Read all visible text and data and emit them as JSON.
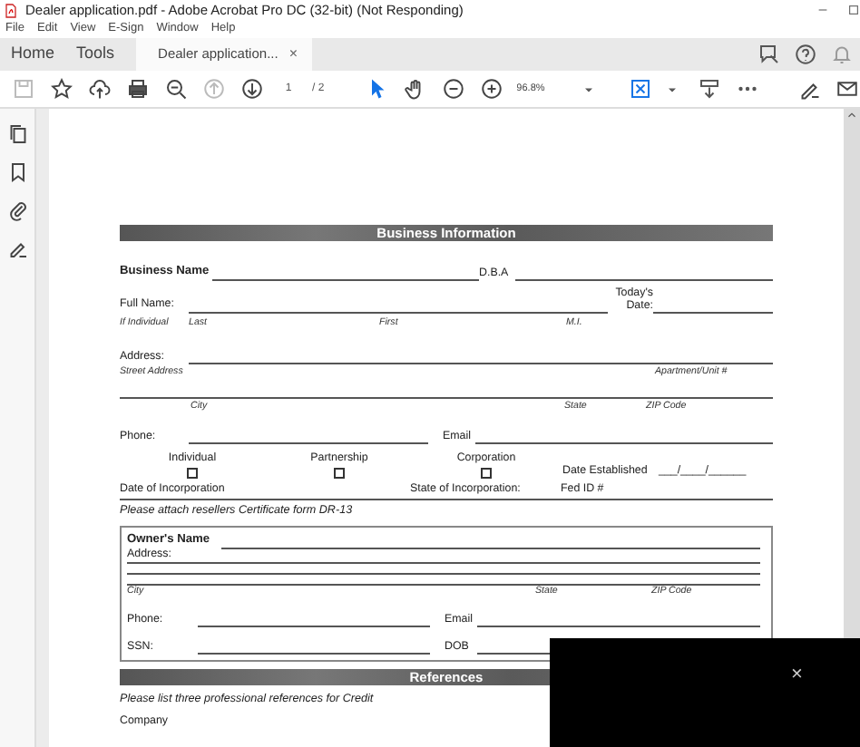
{
  "window": {
    "title": "Dealer application.pdf - Adobe Acrobat Pro DC (32-bit) (Not Responding)"
  },
  "menu": [
    "File",
    "Edit",
    "View",
    "E-Sign",
    "Window",
    "Help"
  ],
  "tabs": [
    {
      "label": "Home",
      "selected": false
    },
    {
      "label": "Tools",
      "selected": false
    },
    {
      "label": "Dealer application...",
      "selected": true,
      "close": "×"
    }
  ],
  "toolbar": {
    "buttons": [
      {
        "disabled": true
      },
      {
        "disabled": false
      },
      {
        "disabled": false
      },
      {
        "disabled": false
      },
      {
        "disabled": false
      },
      {
        "disabled": true
      },
      {
        "disabled": false
      }
    ],
    "page": "1",
    "page_total": "/ 2",
    "tools": [
      {
        "selected": true
      },
      {
        "selected": false
      }
    ],
    "zoom": "96.8%"
  },
  "form": [
    {
      "kind": "heading",
      "text": "Business Information"
    },
    {
      "kind": "row",
      "items": [
        {
          "kind": "strong",
          "text": "Business Name"
        },
        {
          "kind": "line"
        },
        {
          "kind": "label",
          "text": "D.B.A"
        },
        {
          "kind": "line"
        }
      ]
    },
    {
      "kind": "row",
      "items": [
        {
          "kind": "label",
          "text": "Full Name:"
        },
        {
          "kind": "line"
        },
        {
          "kind": "label",
          "text": "Today's Date:"
        },
        {
          "kind": "line"
        }
      ]
    },
    {
      "kind": "row",
      "items": [
        {
          "kind": "hint",
          "text": "If Individual"
        },
        {
          "kind": "hint",
          "text": "Last"
        },
        {
          "kind": "hint",
          "text": "First"
        },
        {
          "kind": "hint",
          "text": "M.I."
        }
      ]
    },
    {
      "kind": "row",
      "items": [
        {
          "kind": "label",
          "text": "Address:"
        },
        {
          "kind": "line"
        }
      ]
    },
    {
      "kind": "row",
      "items": [
        {
          "kind": "hint",
          "text": "Street Address"
        },
        {
          "kind": "hint",
          "text": "Apartment/Unit #"
        }
      ]
    },
    {
      "kind": "row",
      "items": [
        {
          "kind": "line"
        }
      ]
    },
    {
      "kind": "row",
      "items": [
        {
          "kind": "hint",
          "text": "City"
        },
        {
          "kind": "hint",
          "text": "State"
        },
        {
          "kind": "hint",
          "text": "ZIP Code"
        }
      ]
    },
    {
      "kind": "row",
      "items": [
        {
          "kind": "label",
          "text": "Phone:"
        },
        {
          "kind": "line"
        },
        {
          "kind": "label",
          "text": "Email"
        },
        {
          "kind": "line"
        }
      ]
    },
    {
      "kind": "row",
      "items": [
        {
          "kind": "checkbox",
          "text": "Individual",
          "checked": false
        },
        {
          "kind": "checkbox",
          "text": "Partnership",
          "checked": false
        },
        {
          "kind": "checkbox",
          "text": "Corporation",
          "checked": false
        },
        {
          "kind": "label",
          "text": "Date Established"
        },
        {
          "kind": "label",
          "text": "___/____/______"
        }
      ]
    },
    {
      "kind": "row",
      "items": [
        {
          "kind": "label",
          "text": "Date of Incorporation"
        },
        {
          "kind": "label",
          "text": "State of Incorporation:"
        },
        {
          "kind": "label",
          "text": "Fed ID #"
        }
      ]
    },
    {
      "kind": "row",
      "items": [
        {
          "kind": "note",
          "text": "Please attach resellers Certificate form DR-13"
        }
      ]
    },
    {
      "kind": "box",
      "rows": [
        {
          "kind": "row",
          "items": [
            {
              "kind": "strong",
              "text": "Owner's Name"
            },
            {
              "kind": "line"
            }
          ]
        },
        {
          "kind": "row",
          "items": [
            {
              "kind": "label",
              "text": "Address:"
            }
          ]
        },
        {
          "kind": "row",
          "items": [
            {
              "kind": "line"
            }
          ]
        },
        {
          "kind": "row",
          "items": [
            {
              "kind": "line"
            }
          ]
        },
        {
          "kind": "row",
          "items": [
            {
              "kind": "hint",
              "text": "City"
            },
            {
              "kind": "hint",
              "text": "State"
            },
            {
              "kind": "hint",
              "text": "ZIP Code"
            }
          ]
        },
        {
          "kind": "row",
          "items": [
            {
              "kind": "label",
              "text": "Phone:"
            },
            {
              "kind": "line"
            },
            {
              "kind": "label",
              "text": "Email"
            },
            {
              "kind": "line"
            }
          ]
        },
        {
          "kind": "row",
          "items": [
            {
              "kind": "label",
              "text": "SSN:"
            },
            {
              "kind": "line"
            },
            {
              "kind": "label",
              "text": "DOB"
            },
            {
              "kind": "line"
            }
          ]
        }
      ]
    },
    {
      "kind": "heading",
      "text": "References"
    },
    {
      "kind": "row",
      "items": [
        {
          "kind": "note",
          "text": "Please list three professional references for Credit"
        }
      ]
    },
    {
      "kind": "row",
      "items": [
        {
          "kind": "label",
          "text": "Company"
        }
      ]
    }
  ],
  "overlay": {
    "close": "×"
  }
}
